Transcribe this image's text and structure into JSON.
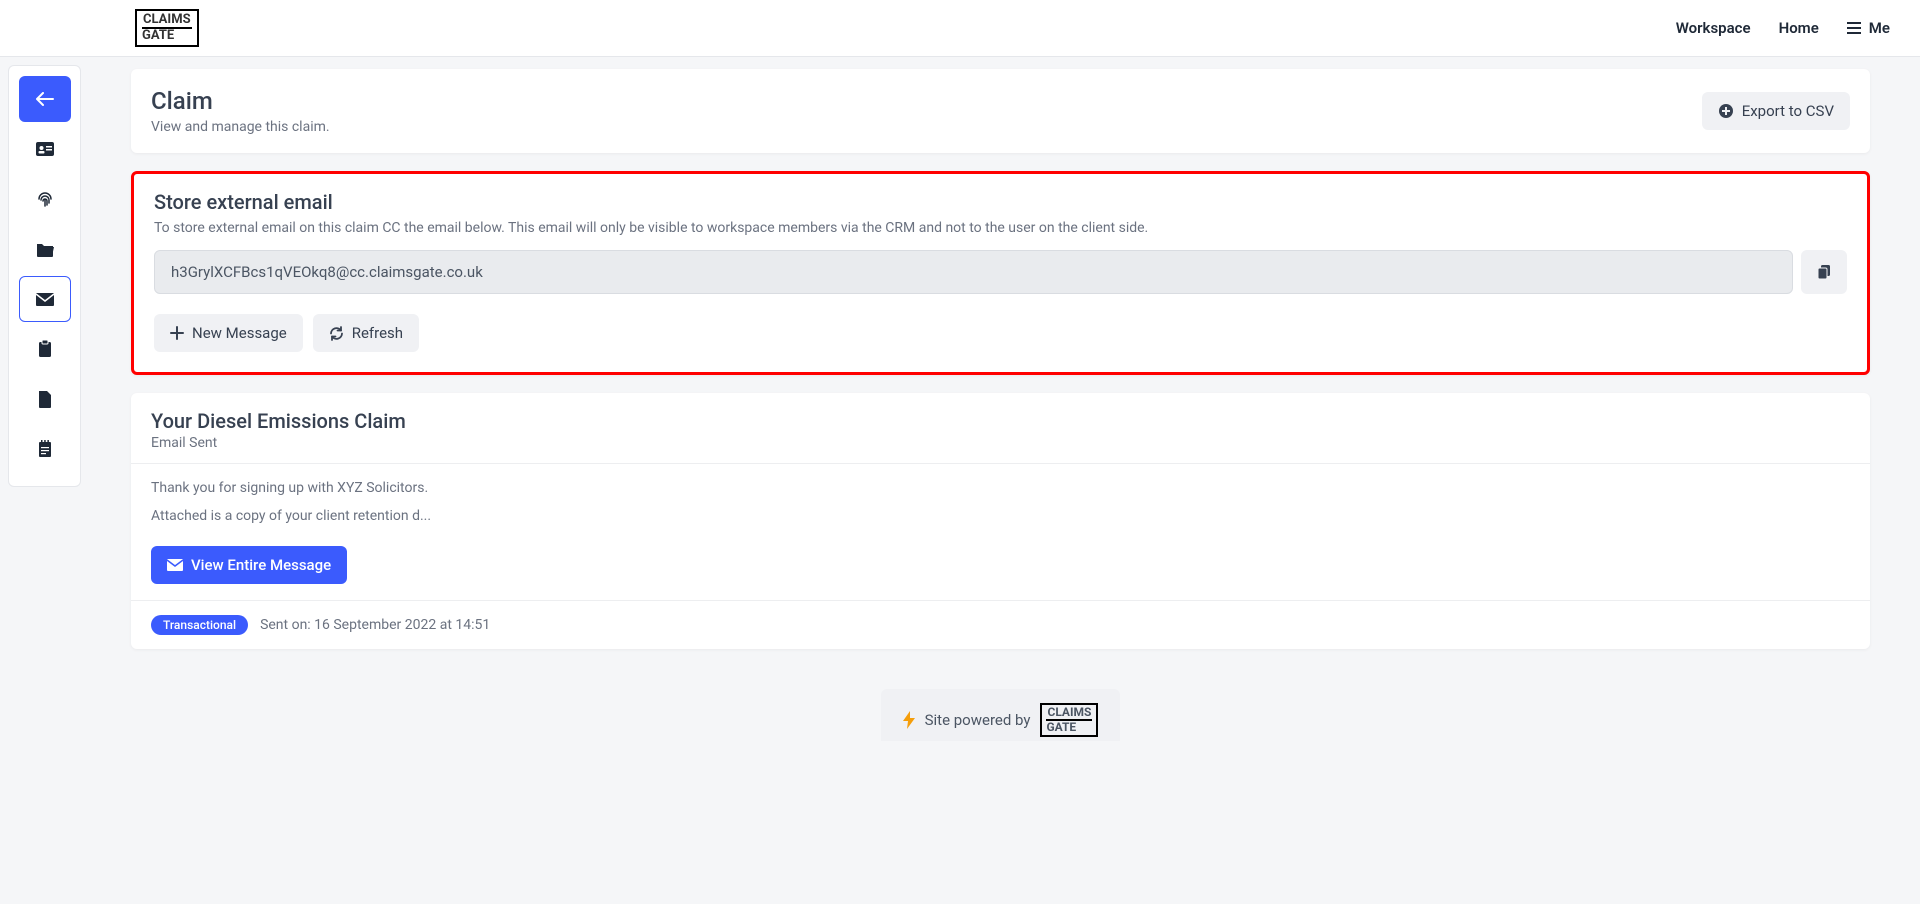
{
  "brand": {
    "line1": "CLAIMS",
    "line2": "GATE"
  },
  "nav": {
    "workspace": "Workspace",
    "home": "Home",
    "me": "Me"
  },
  "claim": {
    "title": "Claim",
    "subtitle": "View and manage this claim.",
    "export_label": "Export to CSV"
  },
  "store_email": {
    "title": "Store external email",
    "desc": "To store external email on this claim CC the email below. This email will only be visible to workspace members via the CRM and not to the user on the client side.",
    "email_value": "h3GrylXCFBcs1qVEOkq8@cc.claimsgate.co.uk",
    "new_message_label": "New Message",
    "refresh_label": "Refresh"
  },
  "message": {
    "title": "Your Diesel Emissions Claim",
    "status": "Email Sent",
    "line1": "Thank you for signing up with XYZ Solicitors.",
    "line2": "Attached is a copy of your client retention d...",
    "view_label": "View Entire Message",
    "tag": "Transactional",
    "sent_on": "Sent on: 16 September 2022 at 14:51"
  },
  "footer": {
    "powered_by": "Site powered by"
  }
}
